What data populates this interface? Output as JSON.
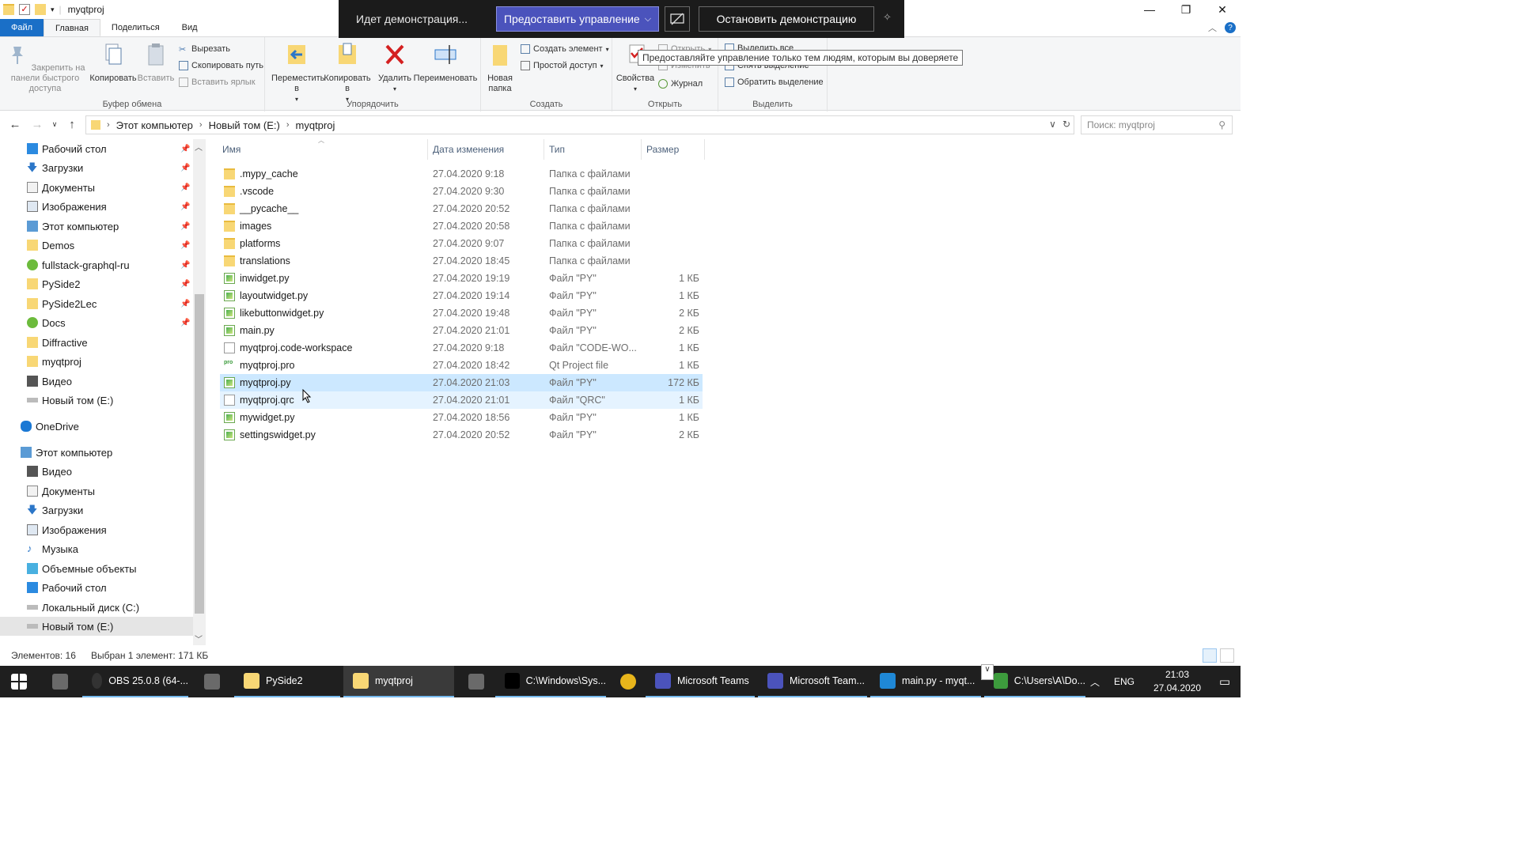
{
  "window": {
    "title": "myqtproj"
  },
  "ribbon_tabs": [
    {
      "label": "Файл"
    },
    {
      "label": "Главная"
    },
    {
      "label": "Поделиться"
    },
    {
      "label": "Вид"
    }
  ],
  "ribbon": {
    "clipboard": {
      "pin": "Закрепить на панели быстрого доступа",
      "copy": "Копировать",
      "paste": "Вставить",
      "cut": "Вырезать",
      "copy_path": "Скопировать путь",
      "paste_shortcut": "Вставить ярлык",
      "group": "Буфер обмена"
    },
    "organize": {
      "move": "Переместить в",
      "copy_to": "Копировать в",
      "delete": "Удалить",
      "rename": "Переименовать",
      "group": "Упорядочить"
    },
    "create": {
      "new_folder": "Новая папка",
      "new_item": "Создать элемент",
      "easy_access": "Простой доступ",
      "group": "Создать"
    },
    "open": {
      "properties": "Свойства",
      "open": "Открыть",
      "edit": "Изменить",
      "history": "Журнал",
      "group": "Открыть"
    },
    "select": {
      "select_all": "Выделить все",
      "select_none": "Снять выделение",
      "invert": "Обратить выделение",
      "group": "Выделить"
    }
  },
  "presentation": {
    "status": "Идет демонстрация...",
    "give_control": "Предоставить управление",
    "stop": "Остановить демонстрацию",
    "tooltip": "Предоставляйте управление только тем людям, которым вы доверяете"
  },
  "address": {
    "crumbs": [
      "Этот компьютер",
      "Новый том (E:)",
      "myqtproj"
    ],
    "search_placeholder": "Поиск: myqtproj"
  },
  "nav_pane": [
    {
      "label": "Рабочий стол",
      "icon": "desktop-icon",
      "pinned": true
    },
    {
      "label": "Загрузки",
      "icon": "download-icon",
      "pinned": true
    },
    {
      "label": "Документы",
      "icon": "documents-icon",
      "pinned": true
    },
    {
      "label": "Изображения",
      "icon": "pictures-icon",
      "pinned": true
    },
    {
      "label": "Этот компьютер",
      "icon": "computer-icon",
      "pinned": true
    },
    {
      "label": "Demos",
      "icon": "folder-icon",
      "pinned": true
    },
    {
      "label": "fullstack-graphql-ru",
      "icon": "sync-folder-icon",
      "pinned": true
    },
    {
      "label": "PySide2",
      "icon": "folder-icon",
      "pinned": true
    },
    {
      "label": "PySide2Lec",
      "icon": "folder-icon",
      "pinned": true
    },
    {
      "label": "Docs",
      "icon": "sync-folder-icon",
      "pinned": true
    },
    {
      "label": "Diffractive",
      "icon": "folder-icon",
      "pinned": false
    },
    {
      "label": "myqtproj",
      "icon": "folder-icon",
      "pinned": false
    },
    {
      "label": "Видео",
      "icon": "video-icon",
      "pinned": false
    },
    {
      "label": "Новый том (E:)",
      "icon": "drive-icon",
      "pinned": false
    },
    {
      "label": "OneDrive",
      "icon": "cloud-icon",
      "pinned": false
    },
    {
      "label": "Этот компьютер",
      "icon": "computer-icon",
      "pinned": false
    },
    {
      "label": "Видео",
      "icon": "video-icon",
      "pinned": false
    },
    {
      "label": "Документы",
      "icon": "documents-icon",
      "pinned": false
    },
    {
      "label": "Загрузки",
      "icon": "download-icon",
      "pinned": false
    },
    {
      "label": "Изображения",
      "icon": "pictures-icon",
      "pinned": false
    },
    {
      "label": "Музыка",
      "icon": "music-icon",
      "pinned": false
    },
    {
      "label": "Объемные объекты",
      "icon": "3d-objects-icon",
      "pinned": false
    },
    {
      "label": "Рабочий стол",
      "icon": "desktop-icon",
      "pinned": false
    },
    {
      "label": "Локальный диск (C:)",
      "icon": "drive-icon",
      "pinned": false
    },
    {
      "label": "Новый том (E:)",
      "icon": "drive-icon",
      "pinned": false
    }
  ],
  "columns": {
    "name": "Имя",
    "date": "Дата изменения",
    "type": "Тип",
    "size": "Размер"
  },
  "files": [
    {
      "name": ".mypy_cache",
      "date": "27.04.2020 9:18",
      "type": "Папка с файлами",
      "size": "",
      "kind": "folder"
    },
    {
      "name": ".vscode",
      "date": "27.04.2020 9:30",
      "type": "Папка с файлами",
      "size": "",
      "kind": "folder"
    },
    {
      "name": "__pycache__",
      "date": "27.04.2020 20:52",
      "type": "Папка с файлами",
      "size": "",
      "kind": "folder"
    },
    {
      "name": "images",
      "date": "27.04.2020 20:58",
      "type": "Папка с файлами",
      "size": "",
      "kind": "folder"
    },
    {
      "name": "platforms",
      "date": "27.04.2020 9:07",
      "type": "Папка с файлами",
      "size": "",
      "kind": "folder"
    },
    {
      "name": "translations",
      "date": "27.04.2020 18:45",
      "type": "Папка с файлами",
      "size": "",
      "kind": "folder"
    },
    {
      "name": "inwidget.py",
      "date": "27.04.2020 19:19",
      "type": "Файл \"PY\"",
      "size": "1 КБ",
      "kind": "py"
    },
    {
      "name": "layoutwidget.py",
      "date": "27.04.2020 19:14",
      "type": "Файл \"PY\"",
      "size": "1 КБ",
      "kind": "py"
    },
    {
      "name": "likebuttonwidget.py",
      "date": "27.04.2020 19:48",
      "type": "Файл \"PY\"",
      "size": "2 КБ",
      "kind": "py"
    },
    {
      "name": "main.py",
      "date": "27.04.2020 21:01",
      "type": "Файл \"PY\"",
      "size": "2 КБ",
      "kind": "py"
    },
    {
      "name": "myqtproj.code-workspace",
      "date": "27.04.2020 9:18",
      "type": "Файл \"CODE-WO...",
      "size": "1 КБ",
      "kind": "doc"
    },
    {
      "name": "myqtproj.pro",
      "date": "27.04.2020 18:42",
      "type": "Qt Project file",
      "size": "1 КБ",
      "kind": "pro"
    },
    {
      "name": "myqtproj.py",
      "date": "27.04.2020 21:03",
      "type": "Файл \"PY\"",
      "size": "172 КБ",
      "kind": "py",
      "state": "selected"
    },
    {
      "name": "myqtproj.qrc",
      "date": "27.04.2020 21:01",
      "type": "Файл \"QRC\"",
      "size": "1 КБ",
      "kind": "doc",
      "state": "hover"
    },
    {
      "name": "mywidget.py",
      "date": "27.04.2020 18:56",
      "type": "Файл \"PY\"",
      "size": "1 КБ",
      "kind": "py"
    },
    {
      "name": "settingswidget.py",
      "date": "27.04.2020 20:52",
      "type": "Файл \"PY\"",
      "size": "2 КБ",
      "kind": "py"
    }
  ],
  "status": {
    "count": "Элементов: 16",
    "selection": "Выбран 1 элемент: 171 КБ"
  },
  "taskbar": [
    {
      "label": "",
      "icon": "start-icon"
    },
    {
      "label": "",
      "icon": "app-icon"
    },
    {
      "label": "OBS 25.0.8 (64-...",
      "icon": "obs-icon"
    },
    {
      "label": "",
      "icon": "app-icon"
    },
    {
      "label": "PySide2",
      "icon": "folder-icon"
    },
    {
      "label": "myqtproj",
      "icon": "folder-icon"
    },
    {
      "label": "",
      "icon": "app-icon"
    },
    {
      "label": "C:\\Windows\\Sys...",
      "icon": "cmd-icon"
    },
    {
      "label": "",
      "icon": "chrome-icon"
    },
    {
      "label": "Microsoft Teams",
      "icon": "teams-icon"
    },
    {
      "label": "Microsoft Team...",
      "icon": "teams-icon"
    },
    {
      "label": "main.py - myqt...",
      "icon": "vscode-icon"
    },
    {
      "label": "C:\\Users\\A\\Do...",
      "icon": "explorer-icon"
    }
  ],
  "tray": {
    "lang": "ENG",
    "time": "21:03",
    "date": "27.04.2020"
  },
  "colors": {
    "accent": "#1a6fc7",
    "selection": "#cce8ff",
    "teams": "#4b53bc"
  }
}
